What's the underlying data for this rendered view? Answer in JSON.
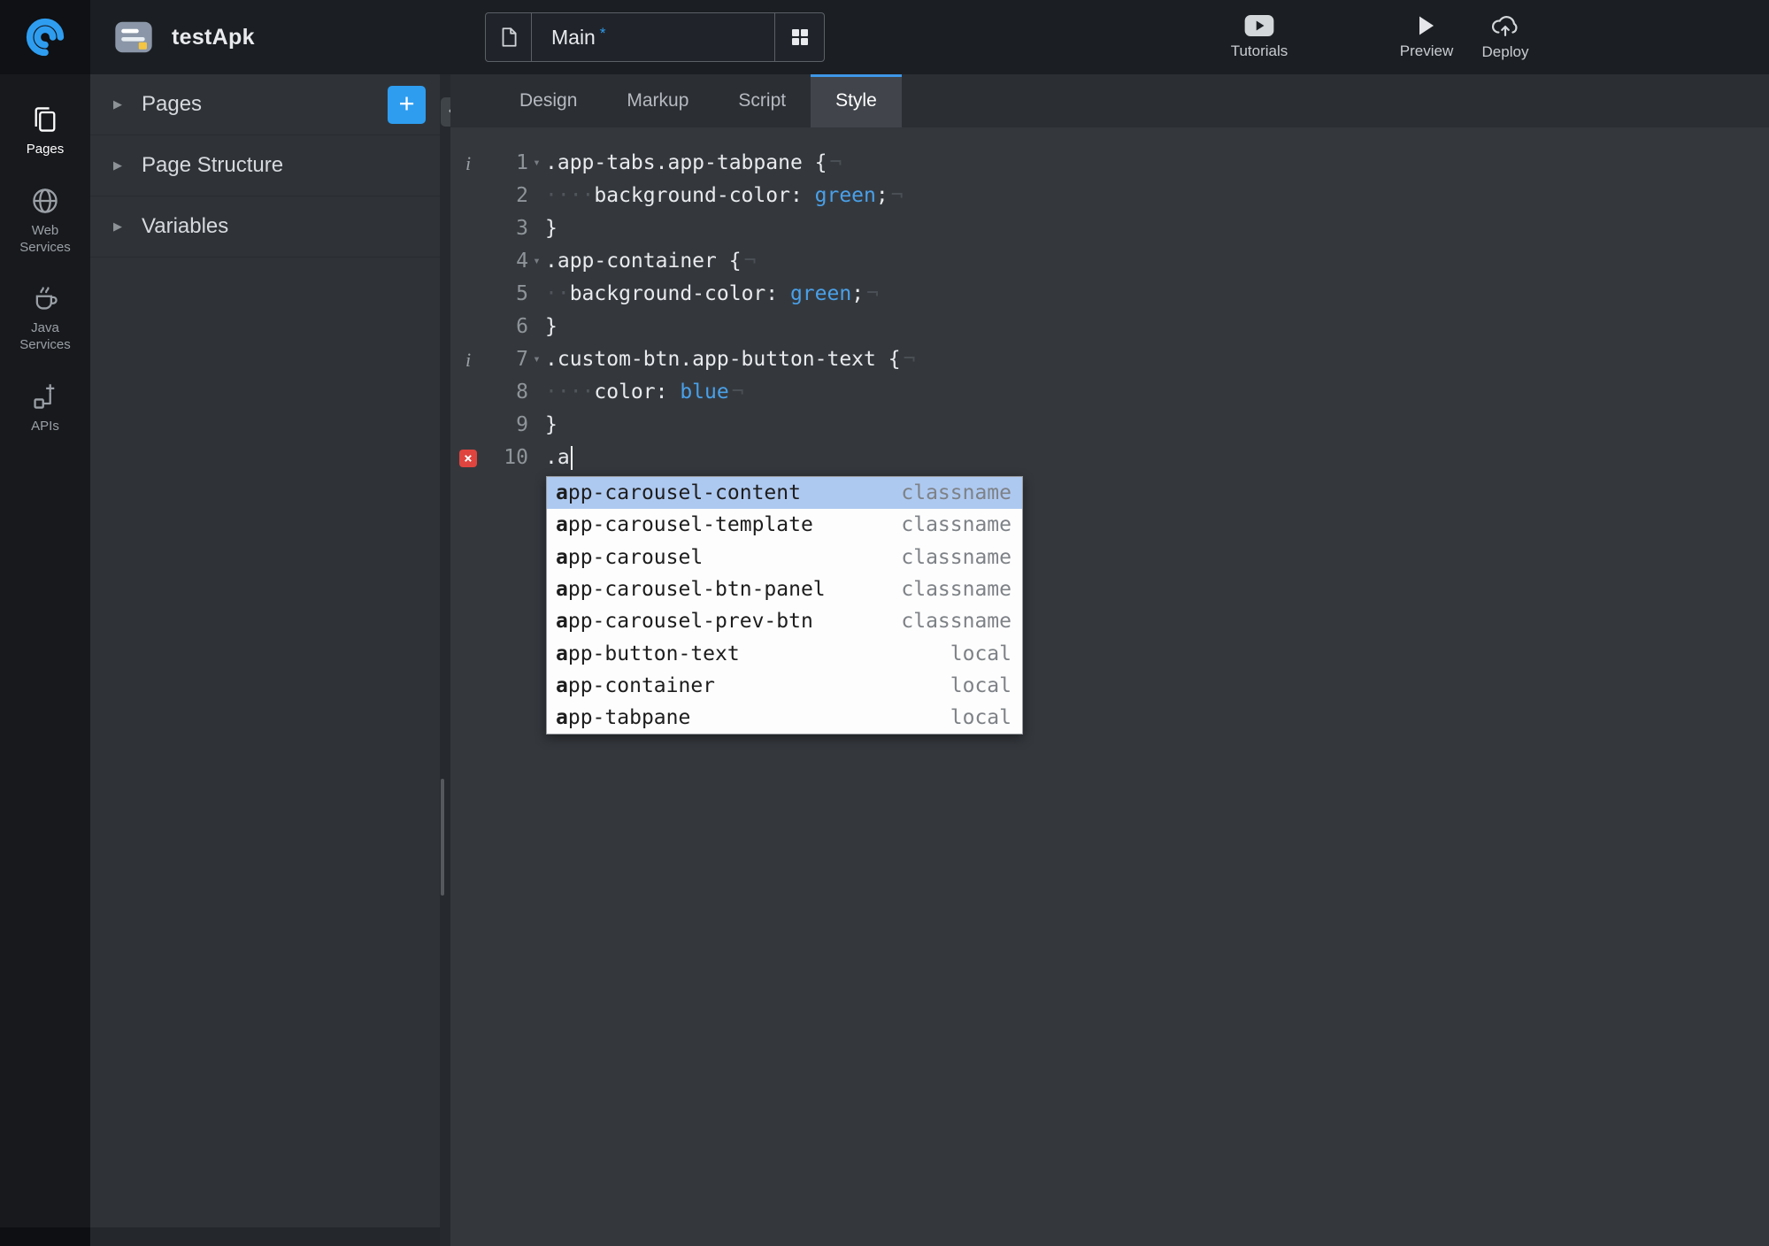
{
  "topbar": {
    "app_name": "testApk",
    "page_selector": {
      "name": "Main",
      "dirty": "*"
    },
    "actions": {
      "tutorials": "Tutorials",
      "preview": "Preview",
      "deploy": "Deploy"
    }
  },
  "rail": {
    "items": [
      {
        "label": "Pages",
        "icon": "pages-icon",
        "active": true
      },
      {
        "label": "Web Services",
        "icon": "web-services-icon",
        "active": false
      },
      {
        "label": "Java Services",
        "icon": "java-services-icon",
        "active": false
      },
      {
        "label": "APIs",
        "icon": "apis-icon",
        "active": false
      }
    ]
  },
  "sidebar": {
    "sections": [
      {
        "label": "Pages",
        "add_button": "+"
      },
      {
        "label": "Page Structure"
      },
      {
        "label": "Variables"
      }
    ]
  },
  "editor": {
    "tabs": [
      {
        "label": "Design",
        "active": false
      },
      {
        "label": "Markup",
        "active": false
      },
      {
        "label": "Script",
        "active": false
      },
      {
        "label": "Style",
        "active": true
      }
    ],
    "code_lines": [
      {
        "num": 1,
        "gutter": "info",
        "fold": true,
        "tokens": [
          {
            "text": ".app-tabs.app-tabpane {",
            "type": "plain"
          },
          {
            "text": "¬",
            "type": "eol"
          }
        ]
      },
      {
        "num": 2,
        "tokens": [
          {
            "text": "····",
            "type": "ws"
          },
          {
            "text": "background-color: ",
            "type": "plain"
          },
          {
            "text": "green",
            "type": "value"
          },
          {
            "text": ";",
            "type": "plain"
          },
          {
            "text": "¬",
            "type": "eol"
          }
        ]
      },
      {
        "num": 3,
        "tokens": [
          {
            "text": "}",
            "type": "plain"
          }
        ]
      },
      {
        "num": 4,
        "fold": true,
        "tokens": [
          {
            "text": ".app-container {",
            "type": "plain"
          },
          {
            "text": "¬",
            "type": "eol"
          }
        ]
      },
      {
        "num": 5,
        "tokens": [
          {
            "text": "··",
            "type": "ws"
          },
          {
            "text": "background-color: ",
            "type": "plain"
          },
          {
            "text": "green",
            "type": "value"
          },
          {
            "text": ";",
            "type": "plain"
          },
          {
            "text": "¬",
            "type": "eol"
          }
        ]
      },
      {
        "num": 6,
        "tokens": [
          {
            "text": "}",
            "type": "plain"
          }
        ]
      },
      {
        "num": 7,
        "gutter": "info",
        "fold": true,
        "tokens": [
          {
            "text": ".custom-btn.app-button-text {",
            "type": "plain"
          },
          {
            "text": "¬",
            "type": "eol"
          }
        ]
      },
      {
        "num": 8,
        "tokens": [
          {
            "text": "····",
            "type": "ws"
          },
          {
            "text": "color: ",
            "type": "plain"
          },
          {
            "text": "blue",
            "type": "value"
          },
          {
            "text": "¬",
            "type": "eol"
          }
        ]
      },
      {
        "num": 9,
        "tokens": [
          {
            "text": "}",
            "type": "plain"
          }
        ]
      },
      {
        "num": 10,
        "gutter": "error",
        "cursor": true,
        "tokens": [
          {
            "text": ".a",
            "type": "plain"
          }
        ]
      }
    ]
  },
  "autocomplete": {
    "items": [
      {
        "name": "app-carousel-content",
        "kind": "classname",
        "selected": true
      },
      {
        "name": "app-carousel-template",
        "kind": "classname",
        "selected": false
      },
      {
        "name": "app-carousel",
        "kind": "classname",
        "selected": false
      },
      {
        "name": "app-carousel-btn-panel",
        "kind": "classname",
        "selected": false
      },
      {
        "name": "app-carousel-prev-btn",
        "kind": "classname",
        "selected": false
      },
      {
        "name": "app-button-text",
        "kind": "local",
        "selected": false
      },
      {
        "name": "app-container",
        "kind": "local",
        "selected": false
      },
      {
        "name": "app-tabpane",
        "kind": "local",
        "selected": false
      }
    ]
  },
  "icons": {
    "section_triangle": "▶",
    "fold_arrow": "▾",
    "collapse_panel": "«",
    "add": "+",
    "error_cross": "×",
    "info": "i",
    "eol_mark": "¬",
    "whitespace_dot": "·"
  },
  "colors": {
    "accent_blue": "#2e9df0",
    "value_token_blue": "#4aa0e8",
    "error_red": "#e0443e",
    "autocomplete_selected": "#aec9f0",
    "active_tab_underline": "#3e97e8"
  }
}
